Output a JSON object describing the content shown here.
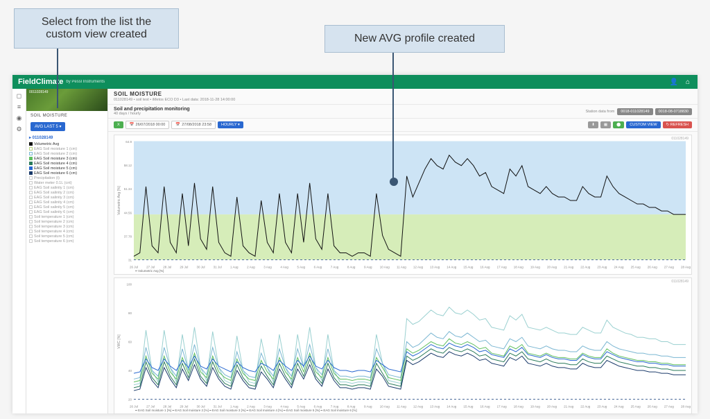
{
  "callouts": {
    "left": "Select from the list the custom view created",
    "right": "New AVG profile created"
  },
  "header": {
    "logo": "FieldClimate",
    "byline": "by Pessl Instruments"
  },
  "sidepanel": {
    "hero": "0011028149",
    "title": "SOIL MOISTURE",
    "avg_button": "AVG LAST 5 ▾",
    "tree_header": "▸ 011028149",
    "items": [
      {
        "label": "Volumetric Avg",
        "color": "#111",
        "on": true
      },
      {
        "label": "EAG Soil moisture 1 (cm)",
        "color": "#b7d27a",
        "on": false
      },
      {
        "label": "EAG Soil moisture 2 (cm)",
        "color": "#7ab6d2",
        "on": false
      },
      {
        "label": "EAG Soil moisture 3 (cm)",
        "color": "#5fbf5f",
        "on": true
      },
      {
        "label": "EAG Soil moisture 4 (cm)",
        "color": "#2a7a5a",
        "on": true
      },
      {
        "label": "EAG Soil moisture 5 (cm)",
        "color": "#2968d0",
        "on": true
      },
      {
        "label": "EAG Soil moisture 6 (cm)",
        "color": "#1a3a6a",
        "on": true
      },
      {
        "label": "Precipitation (t)",
        "color": "#ccc",
        "on": false
      },
      {
        "label": "Water meter 0.1L (cnt)",
        "color": "#ccc",
        "on": false
      },
      {
        "label": "EAG Soil salinity 1 (cm)",
        "color": "#ccc",
        "on": false
      },
      {
        "label": "EAG Soil salinity 2 (cm)",
        "color": "#ccc",
        "on": false
      },
      {
        "label": "EAG Soil salinity 3 (cm)",
        "color": "#ccc",
        "on": false
      },
      {
        "label": "EAG Soil salinity 4 (cm)",
        "color": "#ccc",
        "on": false
      },
      {
        "label": "EAG Soil salinity 5 (cm)",
        "color": "#ccc",
        "on": false
      },
      {
        "label": "EAG Soil salinity 6 (cm)",
        "color": "#ccc",
        "on": false
      },
      {
        "label": "Soil temperature 1 (cm)",
        "color": "#ccc",
        "on": false
      },
      {
        "label": "Soil temperature 2 (cm)",
        "color": "#ccc",
        "on": false
      },
      {
        "label": "Soil temperature 3 (cm)",
        "color": "#ccc",
        "on": false
      },
      {
        "label": "Soil temperature 4 (cm)",
        "color": "#ccc",
        "on": false
      },
      {
        "label": "Soil temperature 5 (cm)",
        "color": "#ccc",
        "on": false
      },
      {
        "label": "Soil temperature 6 (cm)",
        "color": "#ccc",
        "on": false
      }
    ]
  },
  "main": {
    "title": "SOIL MOISTURE",
    "subtitle": "011028149 • soil test • iMetos ECO D3 • Last data: 2018-11-28 14:00:00",
    "section_title": "Soil and precipitation monitoring",
    "section_sub": "40 days / hourly",
    "station_label": "Station data from",
    "badge1": "0018-011028149",
    "badge2": "0018-08-0718830"
  },
  "toolbar": {
    "export": "X",
    "date_from": "26/07/2018 00:00",
    "date_to": "27/08/2018 23:58",
    "hourly": "HOURLY ▾",
    "custom_view": "CUSTOM VIEW",
    "refresh": "↻ REFRESH"
  },
  "chart_data": [
    {
      "type": "line",
      "chart_id": "011028149",
      "title": "Volumetric Avg [%]",
      "ylabel": "Volumetric Avg [%]",
      "ylim": [
        31,
        65
      ],
      "yticks": [
        31.0,
        37.78,
        44.56,
        51.34,
        58.12,
        64.9
      ],
      "x_dates": [
        "26 Jul",
        "27 Jul",
        "28 Jul",
        "29 Jul",
        "30 Jul",
        "31 Jul",
        "1 Aug",
        "2 Aug",
        "3 Aug",
        "4 Aug",
        "5 Aug",
        "6 Aug",
        "7 Aug",
        "8 Aug",
        "9 Aug",
        "10 Aug",
        "11 Aug",
        "12 Aug",
        "13 Aug",
        "14 Aug",
        "15 Aug",
        "16 Aug",
        "17 Aug",
        "18 Aug",
        "19 Aug",
        "20 Aug",
        "21 Aug",
        "22 Aug",
        "23 Aug",
        "24 Aug",
        "25 Aug",
        "26 Aug",
        "27 Aug",
        "28 Aug"
      ],
      "zones": [
        {
          "from": 44,
          "to": 65,
          "color": "#cde4f5"
        },
        {
          "from": 31,
          "to": 44,
          "color": "#d6edb9"
        }
      ],
      "series": [
        {
          "name": "Volumetric Avg",
          "color": "#111",
          "values": [
            32,
            33,
            52,
            35,
            33,
            52,
            36,
            33,
            50,
            35,
            53,
            37,
            34,
            52,
            36,
            33,
            32,
            49,
            35,
            33,
            32,
            48,
            36,
            33,
            50,
            36,
            33,
            50,
            36,
            53,
            37,
            34,
            50,
            35,
            33,
            33,
            32,
            33,
            33,
            32,
            50,
            38,
            34,
            33,
            32,
            55,
            49,
            53,
            57,
            60,
            58,
            57,
            61,
            59,
            58,
            60,
            58,
            55,
            56,
            52,
            51,
            50,
            57,
            55,
            58,
            52,
            51,
            50,
            52,
            50,
            49,
            49,
            48,
            48,
            52,
            50,
            49,
            49,
            55,
            52,
            50,
            49,
            48,
            47,
            47,
            46,
            46,
            45,
            45,
            44,
            44,
            44
          ]
        }
      ],
      "legend": "━ Volumetric Avg [%]"
    },
    {
      "type": "line",
      "chart_id": "011028149",
      "ylabel": "VWC [%]",
      "ylim": [
        20,
        100
      ],
      "yticks": [
        20,
        40,
        60,
        80,
        100
      ],
      "x_dates": [
        "26 Jul",
        "27 Jul",
        "28 Jul",
        "29 Jul",
        "30 Jul",
        "31 Jul",
        "1 Aug",
        "2 Aug",
        "3 Aug",
        "4 Aug",
        "5 Aug",
        "6 Aug",
        "7 Aug",
        "8 Aug",
        "9 Aug",
        "10 Aug",
        "11 Aug",
        "12 Aug",
        "13 Aug",
        "14 Aug",
        "15 Aug",
        "16 Aug",
        "17 Aug",
        "18 Aug",
        "19 Aug",
        "20 Aug",
        "21 Aug",
        "22 Aug",
        "23 Aug",
        "24 Aug",
        "25 Aug",
        "26 Aug",
        "27 Aug",
        "28 Aug"
      ],
      "series": [
        {
          "name": "EAG Soil moisture 1",
          "color": "#9ad0d0",
          "values": [
            30,
            31,
            68,
            40,
            32,
            68,
            42,
            32,
            65,
            40,
            70,
            42,
            33,
            67,
            42,
            33,
            31,
            64,
            40,
            32,
            31,
            62,
            42,
            32,
            65,
            42,
            32,
            65,
            42,
            70,
            42,
            33,
            65,
            40,
            32,
            32,
            31,
            32,
            32,
            31,
            65,
            45,
            33,
            32,
            31,
            76,
            72,
            74,
            78,
            82,
            79,
            78,
            84,
            80,
            79,
            82,
            79,
            75,
            76,
            70,
            69,
            68,
            78,
            75,
            79,
            70,
            69,
            68,
            70,
            68,
            66,
            66,
            65,
            65,
            70,
            68,
            66,
            66,
            75,
            70,
            68,
            66,
            65,
            63,
            63,
            62,
            62,
            60,
            60,
            58,
            58,
            58
          ]
        },
        {
          "name": "EAG Soil moisture 2",
          "color": "#7ab6d2",
          "values": [
            34,
            35,
            56,
            40,
            36,
            56,
            42,
            36,
            55,
            40,
            58,
            42,
            37,
            56,
            42,
            37,
            35,
            53,
            40,
            36,
            35,
            52,
            42,
            36,
            55,
            42,
            36,
            55,
            42,
            58,
            42,
            37,
            55,
            40,
            36,
            36,
            35,
            36,
            36,
            35,
            55,
            45,
            37,
            36,
            35,
            60,
            56,
            58,
            62,
            66,
            63,
            62,
            67,
            64,
            63,
            66,
            63,
            60,
            61,
            57,
            56,
            55,
            62,
            60,
            63,
            57,
            56,
            55,
            57,
            55,
            54,
            54,
            53,
            53,
            57,
            55,
            54,
            54,
            60,
            57,
            55,
            54,
            53,
            52,
            52,
            51,
            51,
            50,
            50,
            49,
            49,
            49
          ]
        },
        {
          "name": "EAG Soil moisture 3",
          "color": "#5fbf5f",
          "values": [
            32,
            33,
            50,
            38,
            34,
            50,
            39,
            34,
            49,
            38,
            52,
            39,
            35,
            50,
            39,
            35,
            33,
            48,
            38,
            34,
            33,
            47,
            39,
            34,
            49,
            39,
            34,
            49,
            39,
            52,
            39,
            35,
            49,
            38,
            34,
            34,
            33,
            34,
            34,
            33,
            49,
            42,
            35,
            34,
            33,
            55,
            52,
            54,
            57,
            60,
            58,
            57,
            62,
            59,
            58,
            60,
            58,
            55,
            56,
            52,
            51,
            50,
            57,
            55,
            58,
            52,
            51,
            50,
            52,
            50,
            49,
            49,
            48,
            48,
            52,
            50,
            49,
            49,
            55,
            52,
            50,
            49,
            48,
            47,
            47,
            46,
            46,
            45,
            45,
            44,
            44,
            44
          ]
        },
        {
          "name": "EAG Soil moisture 4",
          "color": "#2a7a5a",
          "values": [
            28,
            29,
            46,
            35,
            30,
            46,
            36,
            30,
            45,
            35,
            48,
            36,
            31,
            46,
            36,
            31,
            29,
            44,
            35,
            30,
            29,
            43,
            36,
            30,
            45,
            36,
            30,
            45,
            36,
            48,
            36,
            31,
            45,
            35,
            30,
            30,
            29,
            30,
            30,
            29,
            45,
            38,
            31,
            30,
            29,
            50,
            47,
            49,
            52,
            55,
            53,
            52,
            56,
            54,
            53,
            55,
            53,
            50,
            51,
            48,
            47,
            46,
            52,
            50,
            53,
            48,
            47,
            46,
            48,
            46,
            45,
            45,
            44,
            44,
            48,
            46,
            45,
            45,
            50,
            48,
            46,
            45,
            44,
            43,
            43,
            42,
            42,
            41,
            41,
            40,
            40,
            40
          ]
        },
        {
          "name": "EAG Soil moisture 5",
          "color": "#2968d0",
          "values": [
            38,
            39,
            48,
            42,
            40,
            48,
            43,
            40,
            47,
            42,
            50,
            43,
            41,
            48,
            43,
            41,
            39,
            46,
            42,
            40,
            39,
            45,
            43,
            40,
            47,
            43,
            40,
            47,
            43,
            50,
            43,
            41,
            47,
            42,
            40,
            40,
            39,
            40,
            40,
            39,
            47,
            44,
            41,
            40,
            39,
            53,
            50,
            52,
            55,
            58,
            56,
            55,
            59,
            57,
            56,
            58,
            56,
            53,
            54,
            51,
            50,
            49,
            55,
            53,
            56,
            51,
            50,
            49,
            51,
            49,
            48,
            48,
            47,
            47,
            51,
            49,
            48,
            48,
            53,
            51,
            49,
            48,
            47,
            46,
            46,
            45,
            45,
            44,
            44,
            43,
            43,
            43
          ]
        },
        {
          "name": "EAG Soil moisture 6",
          "color": "#1a3a6a",
          "values": [
            26,
            27,
            42,
            33,
            28,
            42,
            34,
            28,
            41,
            33,
            44,
            34,
            29,
            42,
            34,
            29,
            27,
            40,
            33,
            28,
            27,
            39,
            34,
            28,
            41,
            34,
            28,
            41,
            34,
            44,
            34,
            29,
            41,
            33,
            28,
            28,
            27,
            28,
            28,
            27,
            41,
            36,
            29,
            28,
            27,
            47,
            44,
            46,
            49,
            52,
            50,
            49,
            53,
            51,
            50,
            52,
            50,
            47,
            48,
            45,
            44,
            43,
            49,
            47,
            50,
            45,
            44,
            43,
            45,
            43,
            42,
            42,
            41,
            41,
            45,
            43,
            42,
            42,
            47,
            45,
            43,
            42,
            41,
            40,
            40,
            39,
            39,
            38,
            38,
            37,
            37,
            37
          ]
        }
      ],
      "legend": "━ EAG Soil moisture 1 [%]  ━ EAG Soil moisture 2 [%]  ━ EAG Soil moisture 3 [%]  ━ EAG Soil moisture 4 [%]  ━ EAG Soil moisture 5 [%]  ━ EAG Soil moisture 6 [%]"
    }
  ]
}
